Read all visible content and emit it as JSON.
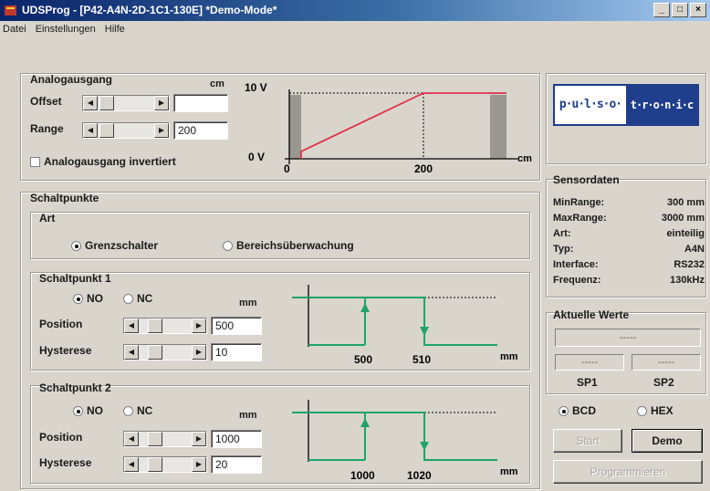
{
  "window": {
    "title": "UDSProg - [P42-A4N-2D-1C1-130E] *Demo-Mode*",
    "btn_min": "_",
    "btn_max": "□",
    "btn_close": "×"
  },
  "menu": [
    "Datei",
    "Einstellungen",
    "Hilfe"
  ],
  "analog": {
    "title": "Analogausgang",
    "unit": "cm",
    "offset_label": "Offset",
    "offset_value": "",
    "range_label": "Range",
    "range_value": "200",
    "invert_label": "Analogausgang invertiert",
    "invert_checked": false,
    "chart": {
      "y_top": "10 V",
      "y_bottom": "0 V",
      "x_start": "0",
      "x_mark": "200",
      "x_unit": "cm"
    }
  },
  "schalt": {
    "title": "Schaltpunkte",
    "art_title": "Art",
    "art_options": [
      "Grenzschalter",
      "Bereichsüberwachung"
    ],
    "art_selected": 0,
    "sp1": {
      "title": "Schaltpunkt 1",
      "no": "NO",
      "nc": "NC",
      "mode": "NO",
      "unit": "mm",
      "position_label": "Position",
      "position_value": "500",
      "hysterese_label": "Hysterese",
      "hysterese_value": "10",
      "chart_x1": "500",
      "chart_x2": "510",
      "chart_unit": "mm"
    },
    "sp2": {
      "title": "Schaltpunkt 2",
      "no": "NO",
      "nc": "NC",
      "mode": "NO",
      "unit": "mm",
      "position_label": "Position",
      "position_value": "1000",
      "hysterese_label": "Hysterese",
      "hysterese_value": "20",
      "chart_x1": "1000",
      "chart_x2": "1020",
      "chart_unit": "mm"
    }
  },
  "logo": {
    "left": "p·u·l·s·o·",
    "right": "t·r·o·n·i·c"
  },
  "sensor": {
    "title": "Sensordaten",
    "rows": [
      {
        "k": "MinRange:",
        "v": "300 mm"
      },
      {
        "k": "MaxRange:",
        "v": "3000 mm"
      },
      {
        "k": "Art:",
        "v": "einteilig"
      },
      {
        "k": "Typ:",
        "v": "A4N"
      },
      {
        "k": "Interface:",
        "v": "RS232"
      },
      {
        "k": "Frequenz:",
        "v": "130kHz"
      }
    ]
  },
  "aktuelle": {
    "title": "Aktuelle Werte",
    "main": "-----",
    "sp1_val": "-----",
    "sp2_val": "-----",
    "sp1_label": "SP1",
    "sp2_label": "SP2",
    "bcd": "BCD",
    "hex": "HEX",
    "format": "BCD"
  },
  "buttons": {
    "start": "Start",
    "demo": "Demo",
    "program": "Programmieren"
  },
  "colors": {
    "analog_line": "#e0304a",
    "switch_line": "#1fa36a",
    "title_left": "#0a246a",
    "title_right": "#a6caf0",
    "logo_bg": "#1f3e8c"
  }
}
